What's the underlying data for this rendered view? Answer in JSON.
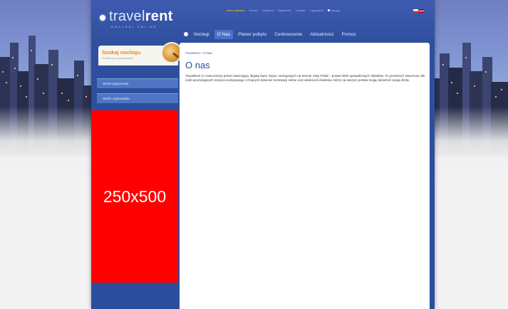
{
  "brand": {
    "name_light": "travel",
    "name_bold": "rent",
    "tagline": "NOCLEGI ONLINE"
  },
  "toplinks": [
    "Strona główna",
    "Pomoc",
    "Reklama",
    "Regulamin",
    "Kontakt",
    "Logowanie",
    "Zaloguj"
  ],
  "menu": {
    "items": [
      "Noclegi",
      "O Nas",
      "Planer pobytu",
      "Cenkowcenie",
      "Aktualności",
      "Pomoc"
    ]
  },
  "sidebar": {
    "search_title": "Szukaj noclegu",
    "search_subtitle": "Przejdź do wyszukiwarki",
    "buttons": [
      "Strefa dyspozenta",
      "Strefa użytkownika"
    ],
    "banner": "250x500"
  },
  "content": {
    "breadcrumb": "Travelrent » O Nas",
    "title": "O nas",
    "paragraph": "TravelRent to nowoczesny portal zawierający ilegatą bazę miejsc noclegowych na terenie całej Polski - ponad 5000 sprawdzonych obiektów. To przestrzeń stworzona dla osób poszukujących miejsca noclegowego i chcących dokonać rezerwacji online oraz właścicieli obiektów, którzy na naszym portalu mogą zamieścić swoją ofertę."
  },
  "colors": {
    "accent": "#2a4c98",
    "banner": "#ff0000",
    "search_title": "#e8891a"
  }
}
